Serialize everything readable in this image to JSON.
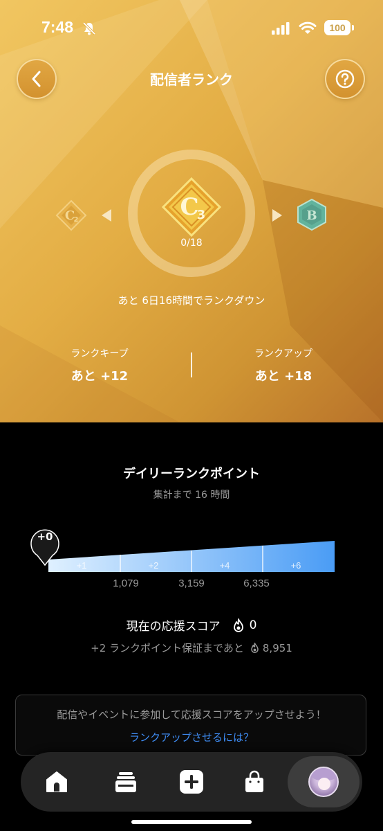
{
  "status_bar": {
    "time": "7:48",
    "battery": "100"
  },
  "header": {
    "title": "配信者ランク"
  },
  "rank": {
    "current_badge": {
      "letter": "C",
      "sub": "3"
    },
    "prev_badge": {
      "letter": "C",
      "sub": "2"
    },
    "next_badge": {
      "letter": "B"
    },
    "progress": "0/18",
    "countdown": "あと 6日16時間でランクダウン"
  },
  "stats": {
    "keep_label": "ランクキープ",
    "keep_value": "あと +12",
    "up_label": "ランクアップ",
    "up_value": "あと +18"
  },
  "daily": {
    "title": "デイリーランクポイント",
    "subtitle": "集計まで 16 時間",
    "marker": "+0",
    "segments": [
      "+1",
      "+2",
      "+4",
      "+6"
    ],
    "thresholds": [
      "1,079",
      "3,159",
      "6,335"
    ]
  },
  "score": {
    "label": "現在の応援スコア",
    "value": "0",
    "guarantee_prefix": "+2 ランクポイント保証まであと",
    "guarantee_value": "8,951"
  },
  "info": {
    "text": "配信やイベントに参加して応援スコアをアップさせよう！",
    "link": "ランクアップさせるには？"
  },
  "nav": {
    "items": [
      "home-icon",
      "cards-icon",
      "plus-icon",
      "shopping-bag-icon",
      "avatar"
    ]
  },
  "colors": {
    "gold": "#e3ad44",
    "link": "#3f8df5",
    "bar_start": "#dff0ff",
    "bar_end": "#4a9cf5"
  }
}
